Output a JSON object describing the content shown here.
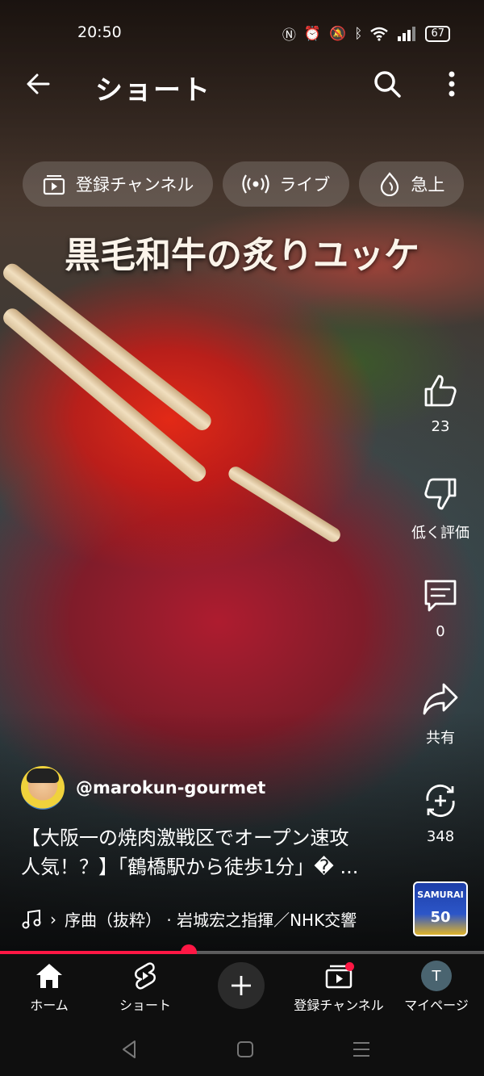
{
  "status_bar": {
    "time": "20:50",
    "battery": "67"
  },
  "app_bar": {
    "title": "ショート"
  },
  "chips": [
    {
      "label": "登録チャンネル",
      "icon": "subscriptions-icon"
    },
    {
      "label": "ライブ",
      "icon": "live-icon"
    },
    {
      "label": "急上",
      "icon": "trending-icon"
    }
  ],
  "video": {
    "caption": "黒毛和牛の炙りユッケ"
  },
  "actions": {
    "like_count": "23",
    "dislike_label": "低く評価",
    "comment_count": "0",
    "share_label": "共有",
    "remix_count": "348"
  },
  "channel": {
    "handle": "@marokun-gourmet"
  },
  "description": {
    "line1": "【大阪一の焼肉激戦区でオープン速攻",
    "line2": "人気！？】「鶴橋駅から徒歩1分」� ..."
  },
  "music": {
    "text": "序曲（抜粋） · 岩城宏之指揮／NHK交響"
  },
  "album": {
    "line1": "SAMURAI",
    "line2": "50"
  },
  "progress": {
    "value": 0.39
  },
  "bottom_nav": [
    {
      "label": "ホーム"
    },
    {
      "label": "ショート"
    },
    {
      "label": ""
    },
    {
      "label": "登録チャンネル"
    },
    {
      "label": "マイページ",
      "avatar_letter": "T"
    }
  ],
  "colors": {
    "accent": "#ff1744",
    "nav_bg": "#0f0f0f"
  }
}
